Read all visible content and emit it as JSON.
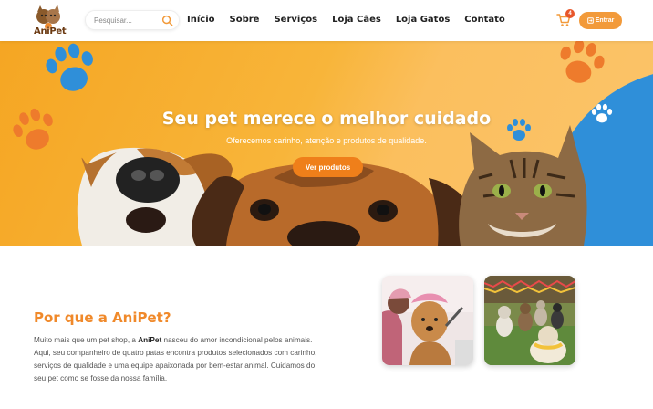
{
  "brand": {
    "logo_text": "AniPet"
  },
  "search": {
    "placeholder": "Pesquisar..."
  },
  "nav": {
    "items": [
      "Início",
      "Sobre",
      "Serviços",
      "Loja Cães",
      "Loja Gatos",
      "Contato"
    ]
  },
  "cart": {
    "count": "4"
  },
  "login": {
    "label": "Entrar",
    "icon": "login-icon"
  },
  "colors": {
    "orange": "#f5a623",
    "accent": "#ef7f1a",
    "blue": "#2f8fd9",
    "title_orange": "#f0892a"
  },
  "hero": {
    "title": "Seu pet merece o melhor cuidado",
    "subtitle": "Oferecemos carinho, atenção e produtos de qualidade.",
    "cta": "Ver produtos"
  },
  "why": {
    "title": "Por que a AniPet?",
    "text_before": "Muito mais que um pet shop, a ",
    "brand": "AniPet",
    "text_after": " nasceu do amor incondicional pelos animais. Aqui, seu companheiro de quatro patas encontra produtos selecionados com carinho, serviços de qualidade e uma equipe apaixonada por bem-estar animal. Cuidamos do seu pet como se fosse da nossa família."
  }
}
